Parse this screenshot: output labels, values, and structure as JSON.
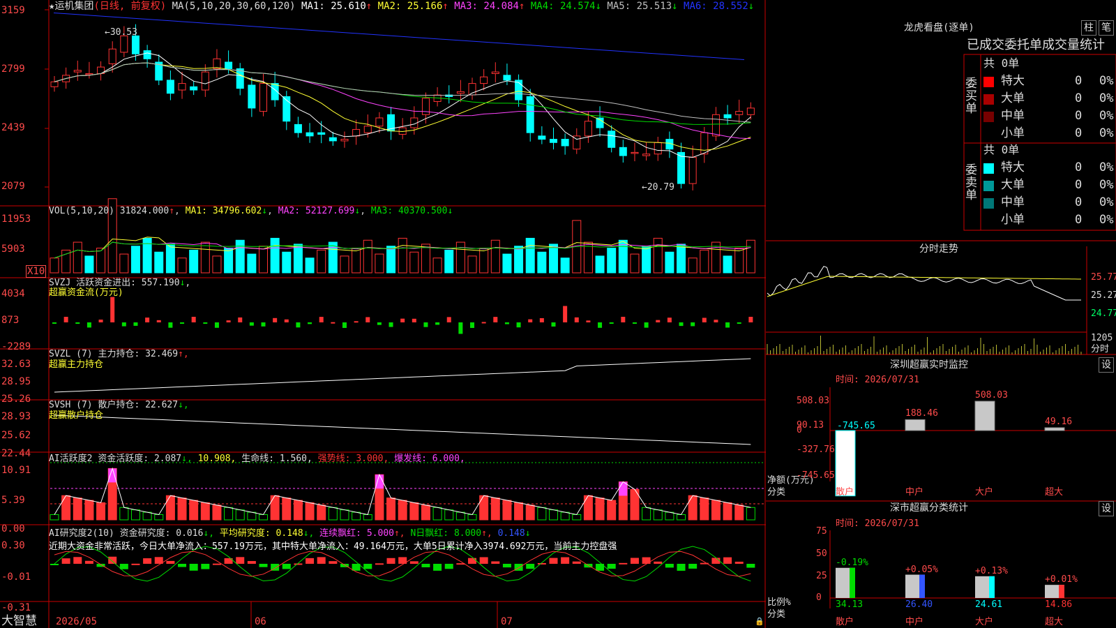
{
  "colors": {
    "up": "#ff3333",
    "down": "#00ffff",
    "ma1": "#ffffff",
    "ma2": "#ffff33",
    "ma3": "#ff44ff",
    "ma4": "#00dd00",
    "ma5": "#c0c0c0",
    "ma6": "#2233ff",
    "grid": "#cc0000"
  },
  "main": {
    "stock": "运机集团",
    "mode": "(日线, 前复权)",
    "ma_label": "MA(5,10,20,30,60,120)",
    "ma": [
      {
        "k": "MA1:",
        "v": "25.610",
        "a": "↑"
      },
      {
        "k": "MA2:",
        "v": "25.166",
        "a": "↑"
      },
      {
        "k": "MA3:",
        "v": "24.084",
        "a": "↑"
      },
      {
        "k": "MA4:",
        "v": "24.574",
        "a": "↓"
      },
      {
        "k": "MA5:",
        "v": "25.513",
        "a": "↓"
      },
      {
        "k": "MA6:",
        "v": "28.552",
        "a": "↓"
      }
    ],
    "yaxis": [
      "3159",
      "2799",
      "2439",
      "2079"
    ],
    "high_mark": "30.53",
    "low_mark": "20.79"
  },
  "vol": {
    "label": "VOL(5,10,20)",
    "value": "31824.000",
    "arrow": "↑",
    "ma1": "34796.602",
    "ma1a": "↓",
    "ma2": "52127.699",
    "ma2a": "↓",
    "ma3": "40370.500",
    "ma3a": "↓",
    "yaxis": [
      "11953",
      "5903"
    ],
    "unit": "X10"
  },
  "svzj": {
    "name": "SVZJ",
    "title": "活跃资金进出:",
    "value": "557.190",
    "arrow": "↓",
    "sub": "超赢资金流(万元)",
    "yaxis": [
      "4034",
      "873",
      "-2289"
    ]
  },
  "svzl": {
    "name": "SVZL (7)",
    "title": "主力持仓:",
    "value": "32.469",
    "arrow": "↑,",
    "sub": "超赢主力持仓",
    "yaxis": [
      "32.63",
      "28.95",
      "25.26"
    ]
  },
  "svsh": {
    "name": "SVSH (7)",
    "title": "散户持仓:",
    "value": "22.627",
    "arrow": "↓,",
    "sub": "超赢散户持仓",
    "yaxis": [
      "28.93",
      "25.62",
      "22.44"
    ]
  },
  "ai1": {
    "name": "AI活跃度2",
    "items": [
      {
        "k": "资金活跃度:",
        "v": "2.087",
        "a": "↓,",
        "c": "#ddd"
      },
      {
        "k": "",
        "v": "10.908,",
        "a": "",
        "c": "#ffff33"
      },
      {
        "k": "生命线:",
        "v": "1.560,",
        "a": "",
        "c": "#ddd"
      },
      {
        "k": "强势线:",
        "v": "3.000,",
        "a": "",
        "c": "#ff3333"
      },
      {
        "k": "爆发线:",
        "v": "6.000,",
        "a": "",
        "c": "#ff44ff"
      }
    ],
    "yaxis": [
      "10.91",
      "5.39",
      "0.00"
    ]
  },
  "ai2": {
    "name": "AI研究度2(10)",
    "items": [
      {
        "k": "资金研究度:",
        "v": "0.016",
        "a": "↓,",
        "c": "#ddd"
      },
      {
        "k": "平均研究度:",
        "v": "0.148",
        "a": "↓,",
        "c": "#ffff33"
      },
      {
        "k": "连续飘红:",
        "v": "5.000",
        "a": "↑,",
        "c": "#ff44ff"
      },
      {
        "k": "N日飘红:",
        "v": "8.000",
        "a": "↑,",
        "c": "#00dd00"
      },
      {
        "k": "",
        "v": "0.148",
        "a": "↓",
        "c": "#3355ff"
      }
    ],
    "comment": "近期大资金非常活跃，今日大单净流入：557.19万元，其中特大单净流入：49.164万元，大单5日累计净入3974.692万元，当前主力控盘强",
    "yaxis": [
      "0.30",
      "-0.01",
      "-0.31"
    ]
  },
  "xaxis": {
    "logo": "大智慧",
    "dates": [
      "2026/05",
      "06",
      "07"
    ]
  },
  "lhb": {
    "title": "龙虎看盘(逐单)",
    "btn1": "柱",
    "btn2": "笔",
    "header": "已成交委托单成交量统计",
    "buy_label": "委买单",
    "sell_label": "委卖单",
    "buy": {
      "total": "共 0单",
      "rows": [
        {
          "name": "特大",
          "n": "0",
          "p": "0%",
          "c": "#ff0000"
        },
        {
          "name": "大单",
          "n": "0",
          "p": "0%",
          "c": "#aa0000"
        },
        {
          "name": "中单",
          "n": "0",
          "p": "0%",
          "c": "#770000"
        },
        {
          "name": "小单",
          "n": "0",
          "p": "0%",
          "c": "#000000"
        }
      ]
    },
    "sell": {
      "total": "共 0单",
      "rows": [
        {
          "name": "特大",
          "n": "0",
          "p": "0%",
          "c": "#00ffff"
        },
        {
          "name": "大单",
          "n": "0",
          "p": "0%",
          "c": "#009999"
        },
        {
          "name": "中单",
          "n": "0",
          "p": "0%",
          "c": "#007777"
        },
        {
          "name": "小单",
          "n": "0",
          "p": "0%",
          "c": "#000000"
        }
      ]
    }
  },
  "fenshi": {
    "title": "分时走势",
    "p1": "25.77",
    "p2": "25.27",
    "p3": "24.77",
    "vol": "1205",
    "lbl": "分时"
  },
  "monitor": {
    "title": "深圳超赢实时监控",
    "btn": "设",
    "time": "时间: 2026/07/31",
    "yaxis": [
      "508.03",
      "90.13",
      "0",
      "-327.76",
      "-745.65"
    ],
    "unit": "净额(万元)",
    "unit2": "分类",
    "bars": [
      {
        "cat": "散户",
        "value": -745.65,
        "label": "-745.65"
      },
      {
        "cat": "中户",
        "value": 188.46,
        "label": "188.46"
      },
      {
        "cat": "大户",
        "value": 508.03,
        "label": "508.03"
      },
      {
        "cat": "超大",
        "value": 49.16,
        "label": "49.16"
      }
    ]
  },
  "classify": {
    "title": "深市超赢分类统计",
    "btn": "设",
    "time": "时间: 2026/07/31",
    "yaxis": [
      "75",
      "50",
      "25",
      "0"
    ],
    "unit": "比例%",
    "unit2": "分类",
    "bars": [
      {
        "cat": "散户",
        "value": 34.13,
        "label": "34.13",
        "chg": "-0.19%"
      },
      {
        "cat": "中户",
        "value": 26.4,
        "label": "26.40",
        "chg": "+0.05%"
      },
      {
        "cat": "大户",
        "value": 24.61,
        "label": "24.61",
        "chg": "+0.13%"
      },
      {
        "cat": "超大",
        "value": 14.86,
        "label": "14.86",
        "chg": "+0.01%"
      }
    ]
  }
}
